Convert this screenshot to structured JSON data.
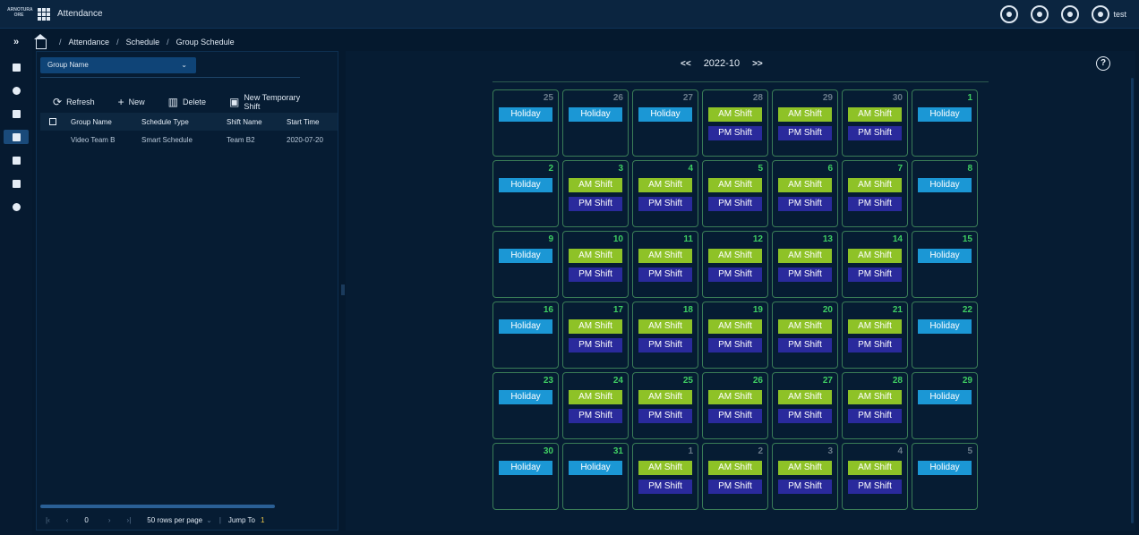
{
  "header": {
    "logo_text": "ARNOTURA ORE",
    "app_title": "Attendance",
    "user_name": "test"
  },
  "breadcrumb": [
    "Attendance",
    "Schedule",
    "Group Schedule"
  ],
  "left_panel": {
    "group_select": "Group Name",
    "toolbar": {
      "refresh": "Refresh",
      "new": "New",
      "delete": "Delete",
      "temp_shift": "New Temporary Shift"
    },
    "table": {
      "columns": [
        "Group Name",
        "Schedule Type",
        "Shift Name",
        "Start Time"
      ],
      "rows": [
        [
          "Video Team B",
          "Smart Schedule",
          "Team B2",
          "2020-07-20"
        ]
      ]
    },
    "pager": {
      "current": "0",
      "rows_per_page": "50 rows per page",
      "jump_to": "Jump To",
      "page": "1"
    }
  },
  "calendar": {
    "prev": "<<",
    "month": "2022-10",
    "next": ">>",
    "labels": {
      "holiday": "Holiday",
      "am": "AM Shift",
      "pm": "PM Shift"
    },
    "colors": {
      "holiday": "#1b97d5",
      "am": "#8ec227",
      "pm": "#2a2a9c",
      "border": "#3a7d57",
      "day_current": "#3fcf63",
      "day_other": "#6a7b8a"
    },
    "days": [
      {
        "d": "25",
        "cur": false,
        "t": "H"
      },
      {
        "d": "26",
        "cur": false,
        "t": "H"
      },
      {
        "d": "27",
        "cur": false,
        "t": "H"
      },
      {
        "d": "28",
        "cur": false,
        "t": "W"
      },
      {
        "d": "29",
        "cur": false,
        "t": "W"
      },
      {
        "d": "30",
        "cur": false,
        "t": "W"
      },
      {
        "d": "1",
        "cur": true,
        "t": "H"
      },
      {
        "d": "2",
        "cur": true,
        "t": "H"
      },
      {
        "d": "3",
        "cur": true,
        "t": "W"
      },
      {
        "d": "4",
        "cur": true,
        "t": "W"
      },
      {
        "d": "5",
        "cur": true,
        "t": "W"
      },
      {
        "d": "6",
        "cur": true,
        "t": "W"
      },
      {
        "d": "7",
        "cur": true,
        "t": "W"
      },
      {
        "d": "8",
        "cur": true,
        "t": "H"
      },
      {
        "d": "9",
        "cur": true,
        "t": "H"
      },
      {
        "d": "10",
        "cur": true,
        "t": "W"
      },
      {
        "d": "11",
        "cur": true,
        "t": "W"
      },
      {
        "d": "12",
        "cur": true,
        "t": "W"
      },
      {
        "d": "13",
        "cur": true,
        "t": "W"
      },
      {
        "d": "14",
        "cur": true,
        "t": "W"
      },
      {
        "d": "15",
        "cur": true,
        "t": "H"
      },
      {
        "d": "16",
        "cur": true,
        "t": "H"
      },
      {
        "d": "17",
        "cur": true,
        "t": "W"
      },
      {
        "d": "18",
        "cur": true,
        "t": "W"
      },
      {
        "d": "19",
        "cur": true,
        "t": "W"
      },
      {
        "d": "20",
        "cur": true,
        "t": "W"
      },
      {
        "d": "21",
        "cur": true,
        "t": "W"
      },
      {
        "d": "22",
        "cur": true,
        "t": "H"
      },
      {
        "d": "23",
        "cur": true,
        "t": "H"
      },
      {
        "d": "24",
        "cur": true,
        "t": "W"
      },
      {
        "d": "25",
        "cur": true,
        "t": "W"
      },
      {
        "d": "26",
        "cur": true,
        "t": "W"
      },
      {
        "d": "27",
        "cur": true,
        "t": "W"
      },
      {
        "d": "28",
        "cur": true,
        "t": "W"
      },
      {
        "d": "29",
        "cur": true,
        "t": "H"
      },
      {
        "d": "30",
        "cur": true,
        "t": "H"
      },
      {
        "d": "31",
        "cur": true,
        "t": "H"
      },
      {
        "d": "1",
        "cur": false,
        "t": "W"
      },
      {
        "d": "2",
        "cur": false,
        "t": "W"
      },
      {
        "d": "3",
        "cur": false,
        "t": "W"
      },
      {
        "d": "4",
        "cur": false,
        "t": "W"
      },
      {
        "d": "5",
        "cur": false,
        "t": "H"
      }
    ]
  }
}
